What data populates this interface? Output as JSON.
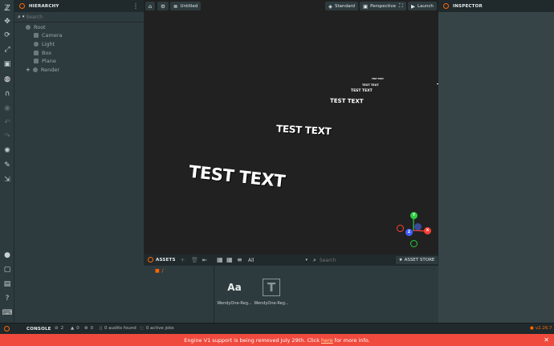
{
  "hierarchy": {
    "title": "HIERARCHY",
    "search_placeholder": "Search",
    "items": [
      {
        "label": "Root"
      },
      {
        "label": "Camera"
      },
      {
        "label": "Light"
      },
      {
        "label": "Box"
      },
      {
        "label": "Plane"
      },
      {
        "label": "Render"
      }
    ]
  },
  "viewport": {
    "scene_name": "Untitled",
    "shading": "Standard",
    "camera": "Perspective",
    "launch": "Launch",
    "texts": [
      "TEST TEXT",
      "TEST TEXT",
      "TEST TEXT",
      "TEST TEXT",
      "TEST TEXT",
      "TEST TEXT"
    ],
    "gizmo": {
      "y": "Y",
      "x": "X",
      "z": "Z"
    }
  },
  "inspector": {
    "title": "INSPECTOR"
  },
  "assets": {
    "title": "ASSETS",
    "filter": "All",
    "search_placeholder": "Search",
    "store": "ASSET STORE",
    "path": "/",
    "files": [
      {
        "thumb": "Aa",
        "label": "WendyOne-Reg..."
      },
      {
        "thumb": "T",
        "label": "WendyOne-Reg..."
      }
    ]
  },
  "console": {
    "title": "CONSOLE",
    "errors": "2",
    "warnings": "0",
    "infos": "0",
    "audits": "0 audits found",
    "jobs": "0 active jobs",
    "version": "v2.26.7"
  },
  "banner": {
    "text_before": "Engine V1 support is being removed July 29th. Click",
    "link": "here",
    "text_after": "for more info."
  },
  "colors": {
    "accent": "#ff6600",
    "banner": "#f04a3e",
    "viewport": "#212121"
  }
}
